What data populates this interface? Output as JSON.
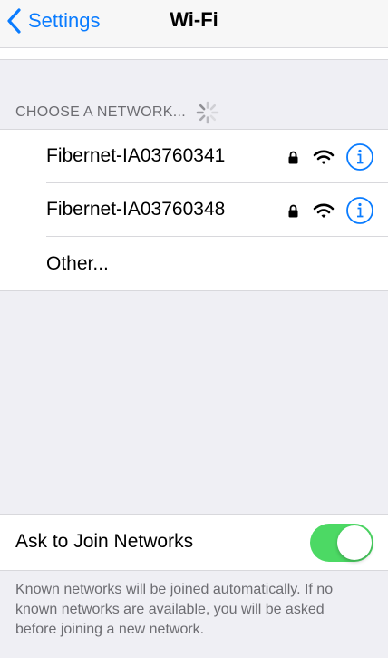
{
  "navbar": {
    "back_label": "Settings",
    "title": "Wi-Fi"
  },
  "networks_section": {
    "header": "CHOOSE A NETWORK...",
    "networks": [
      {
        "name": "Fibernet-IA03760341",
        "secured": true
      },
      {
        "name": "Fibernet-IA03760348",
        "secured": true
      }
    ],
    "other_label": "Other..."
  },
  "ask_to_join": {
    "label": "Ask to Join Networks",
    "enabled": true
  },
  "footer_note": "Known networks will be joined automatically. If no known networks are available, you will be asked before joining a new network.",
  "colors": {
    "accent": "#0a7cff",
    "toggle_on": "#4cd964",
    "background": "#efeff4",
    "secondary_text": "#6d6d72"
  },
  "icons": [
    "chevron-left-icon",
    "spinner-icon",
    "lock-icon",
    "wifi-icon",
    "info-icon"
  ]
}
